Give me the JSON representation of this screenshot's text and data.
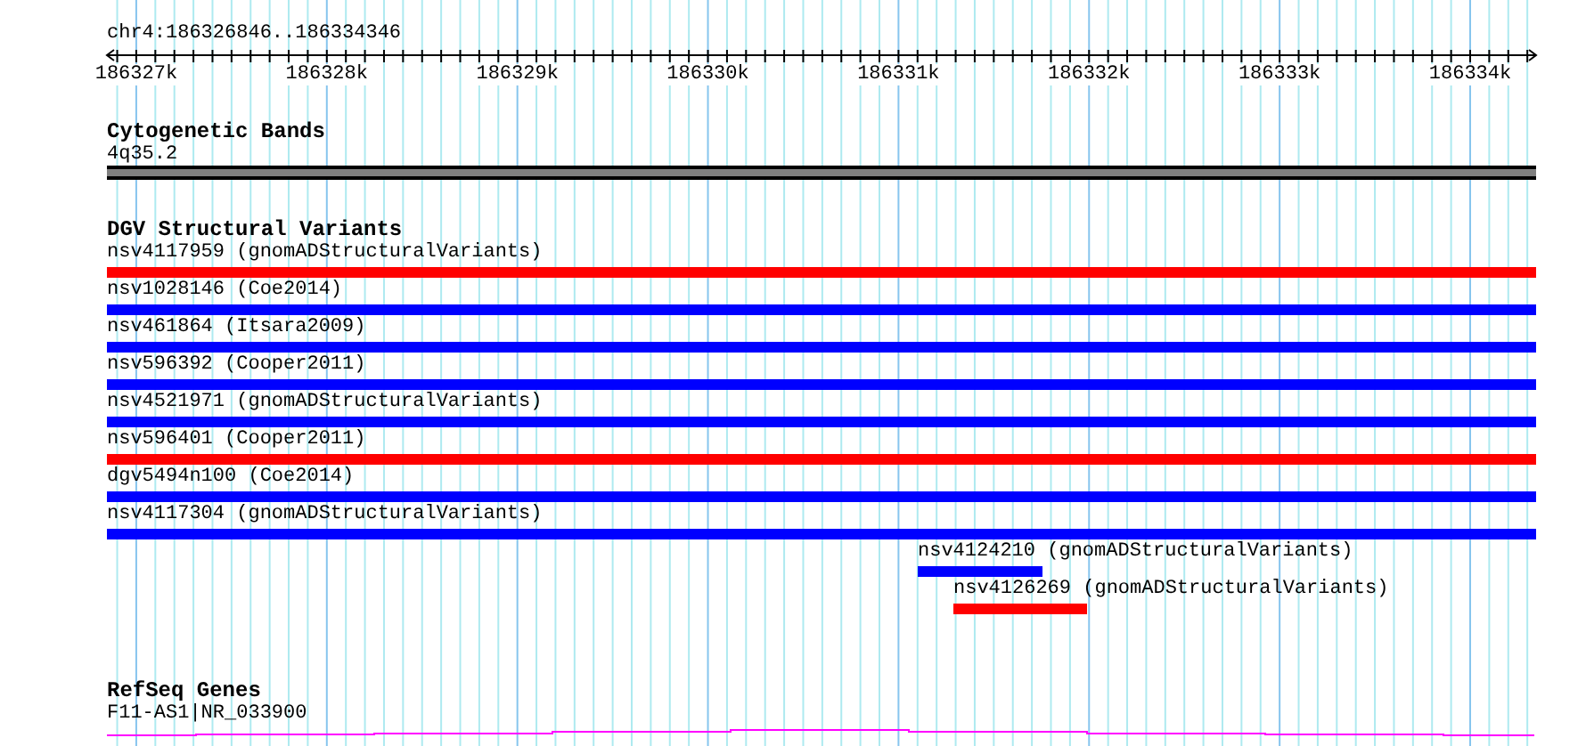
{
  "ruler": {
    "region": "chr4:186326846..186334346",
    "ticks": [
      "186327k",
      "186328k",
      "186329k",
      "186330k",
      "186331k",
      "186332k",
      "186333k",
      "186334k"
    ]
  },
  "tracks": [
    {
      "kind": "bands",
      "title": "Cytogenetic Bands",
      "features": [
        {
          "label": "4q35.2",
          "color": "#808080"
        }
      ]
    },
    {
      "kind": "variants",
      "title": "DGV Structural Variants",
      "features": [
        {
          "label": "nsv4117959 (gnomADStructuralVariants)",
          "color": "#ff0000"
        },
        {
          "label": "nsv1028146 (Coe2014)",
          "color": "#0000ff"
        },
        {
          "label": "nsv461864 (Itsara2009)",
          "color": "#0000ff"
        },
        {
          "label": "nsv596392 (Cooper2011)",
          "color": "#0000ff"
        },
        {
          "label": "nsv4521971 (gnomADStructuralVariants)",
          "color": "#0000ff"
        },
        {
          "label": "nsv596401 (Cooper2011)",
          "color": "#ff0000"
        },
        {
          "label": "dgv5494n100 (Coe2014)",
          "color": "#0000ff"
        },
        {
          "label": "nsv4117304 (gnomADStructuralVariants)",
          "color": "#0000ff"
        },
        {
          "label": "nsv4124210 (gnomADStructuralVariants)",
          "color": "#0000ff"
        },
        {
          "label": "nsv4126269 (gnomADStructuralVariants)",
          "color": "#ff0000"
        }
      ]
    },
    {
      "kind": "genes",
      "title": "RefSeq Genes",
      "features": [
        {
          "label": "F11-AS1|NR_033900",
          "color": "#ff00ff"
        }
      ]
    }
  ]
}
